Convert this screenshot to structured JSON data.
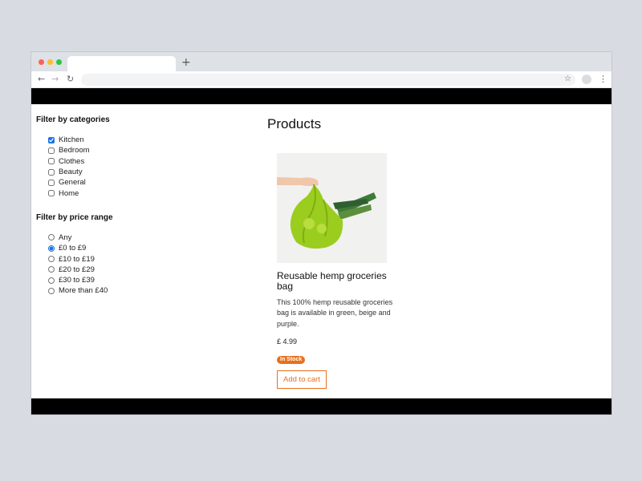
{
  "browser": {
    "new_tab_icon": "+",
    "back_icon": "←",
    "forward_icon": "→",
    "reload_icon": "↻",
    "star_icon": "☆",
    "menu_icon": "⋮",
    "address": ""
  },
  "sidebar": {
    "categories_title": "Filter by categories",
    "categories": [
      {
        "label": "Kitchen",
        "checked": true
      },
      {
        "label": "Bedroom",
        "checked": false
      },
      {
        "label": "Clothes",
        "checked": false
      },
      {
        "label": "Beauty",
        "checked": false
      },
      {
        "label": "General",
        "checked": false
      },
      {
        "label": "Home",
        "checked": false
      }
    ],
    "price_title": "Filter by price range",
    "prices": [
      {
        "label": "Any",
        "checked": false
      },
      {
        "label": "£0 to £9",
        "checked": true
      },
      {
        "label": "£10 to £19",
        "checked": false
      },
      {
        "label": "£20 to £29",
        "checked": false
      },
      {
        "label": "£30 to £39",
        "checked": false
      },
      {
        "label": "More than £40",
        "checked": false
      }
    ]
  },
  "main": {
    "title": "Products",
    "product": {
      "name": "Reusable hemp groceries bag",
      "description": "This 100% hemp reusable groceries bag is available in green, beige and purple.",
      "price": "£ 4.99",
      "stock": "In Stock",
      "add_label": "Add to cart"
    }
  },
  "colors": {
    "accent": "#e8701e",
    "header": "#000000",
    "bag": "#9acd1e"
  }
}
